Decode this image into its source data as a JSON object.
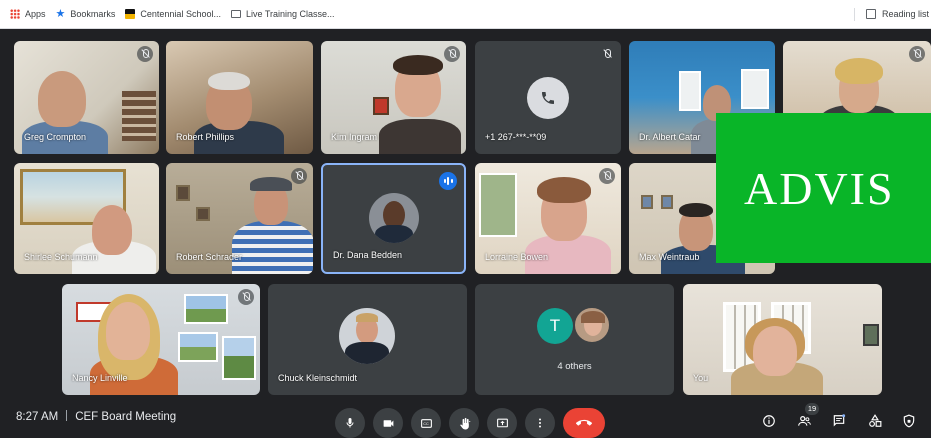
{
  "bookmarks_bar": {
    "items": [
      {
        "label": "Apps",
        "icon": "apps-grid-icon"
      },
      {
        "label": "Bookmarks",
        "icon": "star-icon"
      },
      {
        "label": "Centennial School...",
        "icon": "school-favicon-icon"
      },
      {
        "label": "Live Training Classe...",
        "icon": "page-icon"
      }
    ],
    "reading_list": "Reading list"
  },
  "participants": [
    {
      "name": "Greg Crompton",
      "muted": true
    },
    {
      "name": "Robert Phillips",
      "muted": false
    },
    {
      "name": "Kim Ingram",
      "muted": true
    },
    {
      "name": "+1 267-***-**09",
      "muted": true,
      "type": "phone"
    },
    {
      "name": "Dr. Albert Catar",
      "muted": false
    },
    {
      "name": "",
      "muted": true
    },
    {
      "name": "Shirlee Schumann",
      "muted": false
    },
    {
      "name": "Robert Schrader",
      "muted": true
    },
    {
      "name": "Dr. Dana Bedden",
      "speaking": true,
      "type": "avatar"
    },
    {
      "name": "Lorraine Bowen",
      "muted": true
    },
    {
      "name": "Max Weintraub",
      "muted": false
    },
    {
      "name": "Nancy Linville",
      "muted": true
    },
    {
      "name": "Chuck Kleinschmidt",
      "type": "avatar"
    },
    {
      "name": "4 others",
      "type": "group",
      "initial": "T"
    },
    {
      "name": "You",
      "type": "self"
    }
  ],
  "overlay_banner": "ADVIS",
  "bottom_bar": {
    "time": "8:27 AM",
    "meeting_title": "CEF Board Meeting",
    "controls": [
      "microphone-icon",
      "camera-icon",
      "captions-icon",
      "raise-hand-icon",
      "present-screen-icon",
      "more-options-icon",
      "end-call-icon"
    ],
    "right_controls": [
      "info-icon",
      "people-icon",
      "chat-icon",
      "activities-icon",
      "host-controls-icon"
    ],
    "people_count": "19"
  },
  "colors": {
    "background": "#202124",
    "tile": "#3c4043",
    "accent": "#1a73e8",
    "end_call": "#ea4335",
    "banner": "#09b528"
  }
}
